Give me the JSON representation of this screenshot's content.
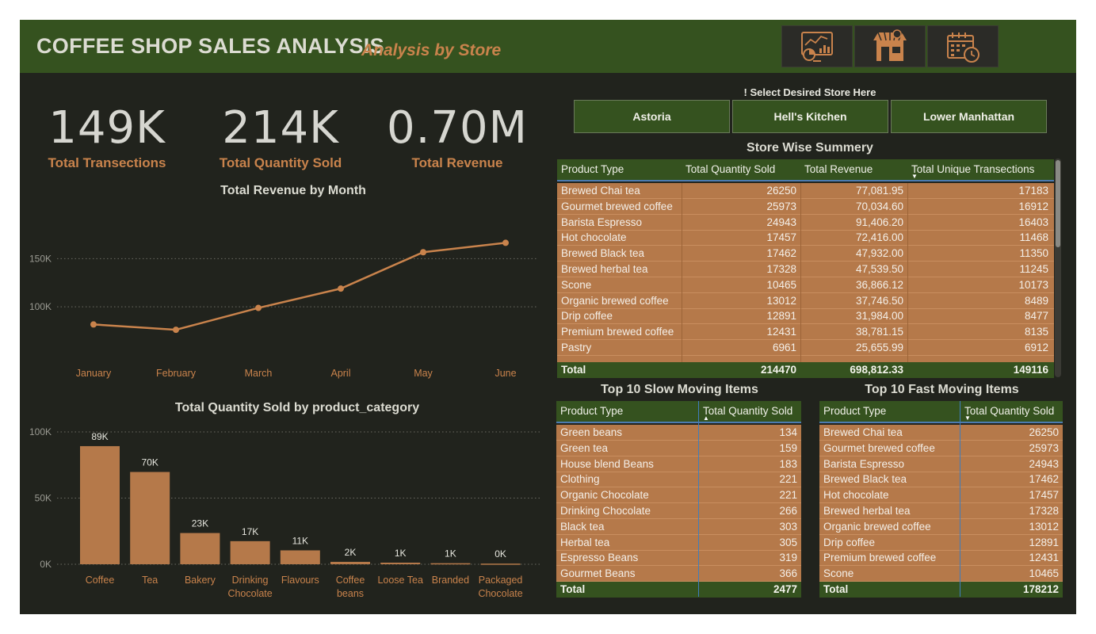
{
  "header": {
    "title": "COFFEE SHOP SALES ANALYSIS",
    "subtitle": "Analysis by Store",
    "nav_icons": [
      "dashboard-chart-icon",
      "store-icon",
      "calendar-clock-icon"
    ]
  },
  "kpis": [
    {
      "value": "149K",
      "label": "Total Transections"
    },
    {
      "value": "214K",
      "label": "Total Quantity Sold"
    },
    {
      "value": "0.70M",
      "label": "Total Revenue"
    }
  ],
  "colors": {
    "header_bg": "#35521f",
    "canvas_bg": "#21231d",
    "accent": "#c9834c",
    "bar": "#b5794a",
    "table_body": "#b5794a"
  },
  "chart_data": [
    {
      "type": "line",
      "title": "Total Revenue by Month",
      "categories": [
        "January",
        "February",
        "March",
        "April",
        "May",
        "June"
      ],
      "values": [
        81678,
        76145,
        98835,
        118941,
        156728,
        166486
      ],
      "yticks": [
        {
          "value": 100000,
          "label": "100K"
        },
        {
          "value": 150000,
          "label": "150K"
        }
      ],
      "ylim": [
        40000,
        180000
      ],
      "grid": true
    },
    {
      "type": "bar",
      "title": "Total Quantity Sold by product_category",
      "categories": [
        "Coffee",
        "Tea",
        "Bakery",
        "Drinking Chocolate",
        "Flavours",
        "Coffee beans",
        "Loose Tea",
        "Branded",
        "Packaged Chocolate"
      ],
      "category_lines": [
        [
          "Coffee"
        ],
        [
          "Tea"
        ],
        [
          "Bakery"
        ],
        [
          "Drinking",
          "Chocolate"
        ],
        [
          "Flavours"
        ],
        [
          "Coffee",
          "beans"
        ],
        [
          "Loose Tea"
        ],
        [
          "Branded"
        ],
        [
          "Packaged",
          "Chocolate"
        ]
      ],
      "values": [
        89250,
        69737,
        23604,
        17457,
        10511,
        1828,
        1210,
        776,
        487
      ],
      "data_labels": [
        "89K",
        "70K",
        "23K",
        "17K",
        "11K",
        "2K",
        "1K",
        "1K",
        "0K"
      ],
      "yticks": [
        {
          "value": 0,
          "label": "0K"
        },
        {
          "value": 50000,
          "label": "50K"
        },
        {
          "value": 100000,
          "label": "100K"
        }
      ],
      "ylim": [
        0,
        100000
      ],
      "grid": true
    }
  ],
  "store_selector": {
    "label": "! Select Desired Store Here",
    "stores": [
      "Astoria",
      "Hell's Kitchen",
      "Lower Manhattan"
    ]
  },
  "store_summary": {
    "title": "Store Wise Summery",
    "columns": [
      "Product Type",
      "Total Quantity Sold",
      "Total Revenue",
      "Total Unique Transections"
    ],
    "rows": [
      [
        "Brewed Chai tea",
        "26250",
        "77,081.95",
        "17183"
      ],
      [
        "Gourmet brewed coffee",
        "25973",
        "70,034.60",
        "16912"
      ],
      [
        "Barista Espresso",
        "24943",
        "91,406.20",
        "16403"
      ],
      [
        "Hot chocolate",
        "17457",
        "72,416.00",
        "11468"
      ],
      [
        "Brewed Black tea",
        "17462",
        "47,932.00",
        "11350"
      ],
      [
        "Brewed herbal tea",
        "17328",
        "47,539.50",
        "11245"
      ],
      [
        "Scone",
        "10465",
        "36,866.12",
        "10173"
      ],
      [
        "Organic brewed coffee",
        "13012",
        "37,746.50",
        "8489"
      ],
      [
        "Drip coffee",
        "12891",
        "31,984.00",
        "8477"
      ],
      [
        "Premium brewed coffee",
        "12431",
        "38,781.15",
        "8135"
      ],
      [
        "Pastry",
        "6961",
        "25,655.99",
        "6912"
      ]
    ],
    "total": [
      "Total",
      "214470",
      "698,812.33",
      "149116"
    ]
  },
  "slow_moving": {
    "title": "Top 10 Slow Moving Items",
    "columns": [
      "Product Type",
      "Total Quantity Sold"
    ],
    "rows": [
      [
        "Green beans",
        "134"
      ],
      [
        "Green tea",
        "159"
      ],
      [
        "House blend Beans",
        "183"
      ],
      [
        "Clothing",
        "221"
      ],
      [
        "Organic Chocolate",
        "221"
      ],
      [
        "Drinking Chocolate",
        "266"
      ],
      [
        "Black tea",
        "303"
      ],
      [
        "Herbal tea",
        "305"
      ],
      [
        "Espresso Beans",
        "319"
      ],
      [
        "Gourmet Beans",
        "366"
      ]
    ],
    "total": [
      "Total",
      "2477"
    ]
  },
  "fast_moving": {
    "title": "Top 10 Fast Moving Items",
    "columns": [
      "Product Type",
      "Total Quantity Sold"
    ],
    "rows": [
      [
        "Brewed Chai tea",
        "26250"
      ],
      [
        "Gourmet brewed coffee",
        "25973"
      ],
      [
        "Barista Espresso",
        "24943"
      ],
      [
        "Brewed Black tea",
        "17462"
      ],
      [
        "Hot chocolate",
        "17457"
      ],
      [
        "Brewed herbal tea",
        "17328"
      ],
      [
        "Organic brewed coffee",
        "13012"
      ],
      [
        "Drip coffee",
        "12891"
      ],
      [
        "Premium brewed coffee",
        "12431"
      ],
      [
        "Scone",
        "10465"
      ]
    ],
    "total": [
      "Total",
      "178212"
    ]
  }
}
